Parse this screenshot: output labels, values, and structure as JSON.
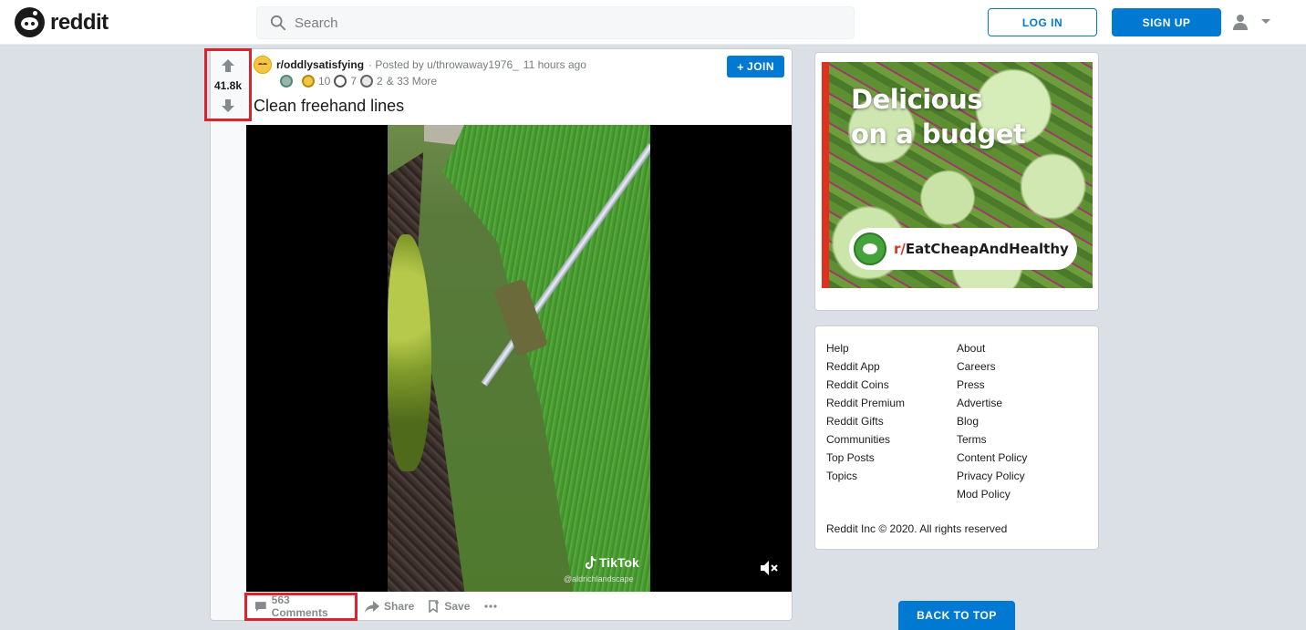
{
  "header": {
    "logo_text": "reddit",
    "search_placeholder": "Search",
    "login_label": "LOG IN",
    "signup_label": "SIGN UP"
  },
  "post": {
    "score": "41.8k",
    "subreddit": "r/oddlysatisfying",
    "posted_by": "· Posted by u/throwaway1976_",
    "time": "11 hours ago",
    "join_label": "JOIN",
    "awards": [
      {
        "icon": "silver-award-icon",
        "count": ""
      },
      {
        "icon": "gold-award-icon",
        "count": "10"
      },
      {
        "icon": "wholesome-award-icon",
        "count": "7"
      },
      {
        "icon": "helpful-award-icon",
        "count": "2"
      }
    ],
    "awards_more": "& 33 More",
    "title": "Clean freehand lines",
    "video": {
      "watermark": "TikTok",
      "handle": "@aldrichlandscape"
    },
    "actions": {
      "comments": "563 Comments",
      "share": "Share",
      "save": "Save"
    }
  },
  "ad": {
    "headline_line1": "Delicious",
    "headline_line2": "on a budget",
    "subreddit_prefix": "r/",
    "subreddit_name": "EatCheapAndHealthy"
  },
  "links": {
    "col1": [
      "Help",
      "Reddit App",
      "Reddit Coins",
      "Reddit Premium",
      "Reddit Gifts",
      "Communities",
      "Top Posts",
      "Topics"
    ],
    "col2": [
      "About",
      "Careers",
      "Press",
      "Advertise",
      "Blog",
      "Terms",
      "Content Policy",
      "Privacy Policy",
      "Mod Policy"
    ],
    "copyright": "Reddit Inc © 2020. All rights reserved"
  },
  "back_to_top": "BACK TO TOP",
  "colors": {
    "brand_blue": "#0079d3",
    "highlight_red": "#d9232e",
    "background": "#dae0e6"
  }
}
